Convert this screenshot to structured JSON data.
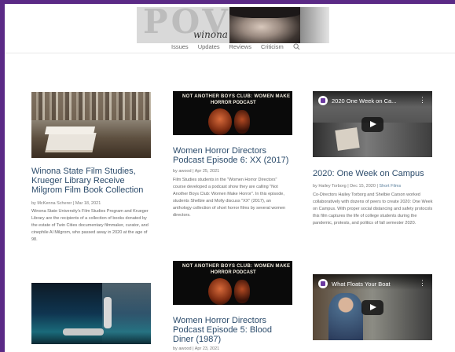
{
  "site": {
    "logo_text": "POV",
    "logo_subtext": "winona",
    "nav": [
      "Issues",
      "Updates",
      "Reviews",
      "Criticism"
    ],
    "search_icon": "search-icon",
    "frame_color": "#5b2a86",
    "link_color": "#2b4b6b"
  },
  "posts": [
    {
      "title": "Winona State Film Studies, Krueger Library Receive Milgrom Film Book Collection",
      "author": "by McKenna Scherer",
      "date": "Mar 18, 2021",
      "excerpt": "Winona State University's Film Studies Program and Krueger Library are the recipients of a collection of books donated by the estate of Twin Cities documentary filmmaker, curator, and cinephile Al Milgrom, who passed away in 2020 at the age of 98."
    },
    {
      "thumb_line1": "NOT ANOTHER BOYS CLUB: WOMEN MAKE",
      "thumb_line2": "HORROR PODCAST",
      "title": "Women Horror Directors Podcast Episode 6: XX (2017)",
      "author": "by awood",
      "date": "Apr 25, 2021",
      "excerpt": "Film Studies students in the \"Women Horror Directors\" course developed a podcast show they are calling \"Not Another Boys Club: Women Make Horror\". In this episode, students Shelbie and Molly discuss \"XX\" (2017), an anthology collection of short horror films by several women directors."
    },
    {
      "video_title": "2020 One Week on Ca...",
      "title": "2020: One Week on Campus",
      "author": "by Hailey Torborg",
      "date": "Dec 15, 2020",
      "category": "Short Films",
      "excerpt": "Co-Directors Hailey Torborg and Shelbie Carson worked collaboratively with dozens of peers to create 2020: One Week on Campus. With proper social distancing and safety protocols this film captures the life of college students during the pandemic, protests, and politics of fall semester 2020."
    },
    {
      "thumb_line1": "NOT ANOTHER BOYS CLUB: WOMEN MAKE",
      "thumb_line2": "HORROR PODCAST",
      "title": "Women Horror Directors Podcast Episode 5: Blood Diner (1987)",
      "author": "by awood",
      "date": "Apr 23, 2021"
    },
    {
      "video_title": "What Floats Your Boat"
    }
  ]
}
